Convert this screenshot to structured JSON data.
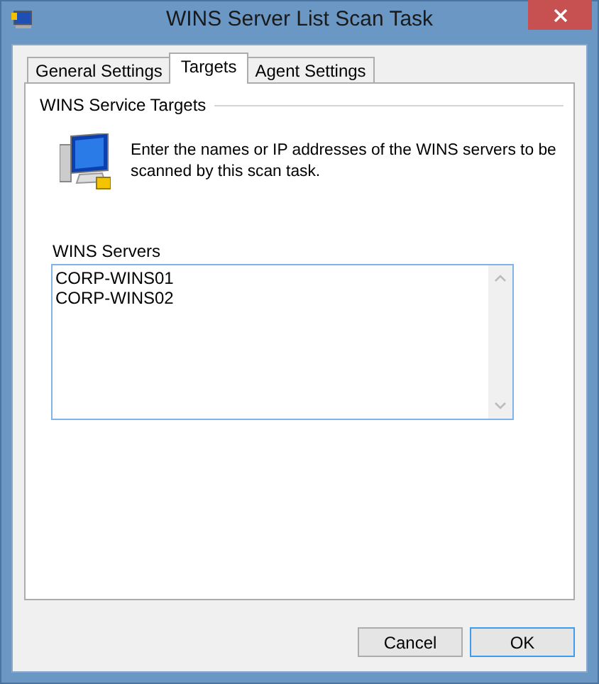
{
  "window": {
    "title": "WINS Server List Scan Task"
  },
  "tabs": [
    {
      "label": "General Settings",
      "selected": false
    },
    {
      "label": "Targets",
      "selected": true
    },
    {
      "label": "Agent Settings",
      "selected": false
    }
  ],
  "group": {
    "title": "WINS Service Targets",
    "description": "Enter the names or IP addresses of the WINS servers to be scanned by this scan task."
  },
  "servers": {
    "label": "WINS Servers",
    "lines": [
      "CORP-WINS01",
      "CORP-WINS02"
    ]
  },
  "buttons": [
    {
      "label": "Cancel",
      "default": false
    },
    {
      "label": "OK",
      "default": true
    }
  ]
}
